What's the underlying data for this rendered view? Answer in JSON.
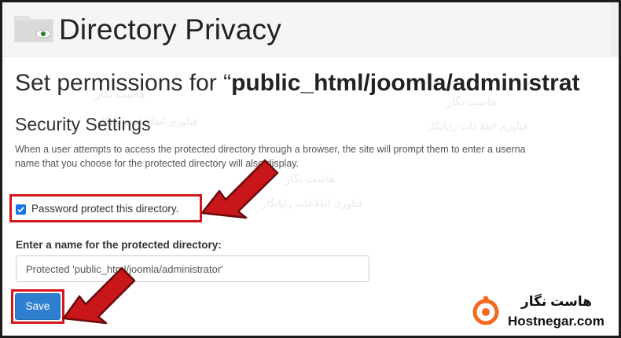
{
  "header": {
    "title": "Directory Privacy"
  },
  "page": {
    "subtitle_prefix": "Set permissions for “",
    "subtitle_path": "public_html/joomla/administrat",
    "section_title": "Security Settings",
    "description_line1": "When a user attempts to access the protected directory through a browser, the site will prompt them to enter a userna",
    "description_line2": "name that you choose for the protected directory will also display."
  },
  "form": {
    "protect_checkbox": {
      "label": "Password protect this directory.",
      "checked": true
    },
    "name_field": {
      "label": "Enter a name for the protected directory:",
      "value": "Protected 'public_html/joomla/administrator'"
    },
    "save_label": "Save"
  },
  "watermark": {
    "brand_fa": "هاست نگار",
    "tagline_fa": "فناوری اطلاعات رایانگار"
  },
  "branding": {
    "name_fa": "هاست نگار",
    "name_en": "Hostnegar.com"
  },
  "colors": {
    "highlight_border": "#d6161b",
    "arrow_red": "#c8161b",
    "save_button": "#2f7fd1",
    "checkbox": "#1a73e8",
    "brand_orange": "#f26a21"
  }
}
